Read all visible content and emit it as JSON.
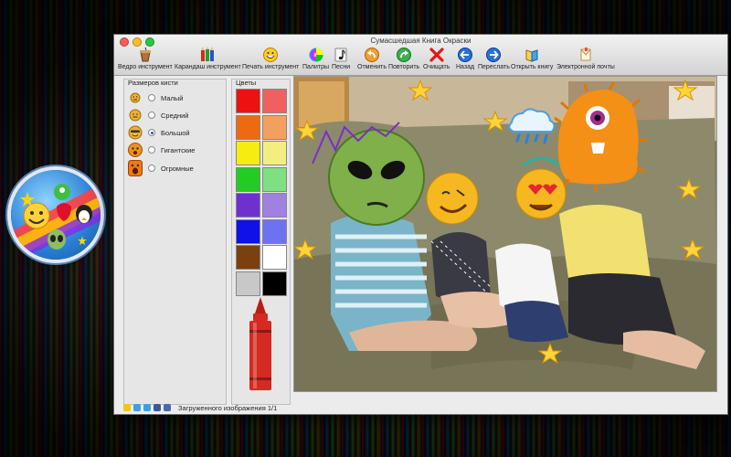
{
  "window": {
    "title": "Сумасшедшая Книга Окраски"
  },
  "toolbar": {
    "items": [
      {
        "label": "Ведро инструмент",
        "icon": "bucket-icon"
      },
      {
        "label": "Карандаш инструмент",
        "icon": "pencils-icon"
      },
      {
        "label": "Печать инструмент",
        "icon": "stamp-smiley-icon"
      },
      {
        "label": "Палитры",
        "icon": "palette-icon"
      },
      {
        "label": "Песни",
        "icon": "music-note-icon"
      },
      {
        "label": "Отменить",
        "icon": "undo-icon"
      },
      {
        "label": "Повторить",
        "icon": "redo-icon"
      },
      {
        "label": "Очищать",
        "icon": "clear-x-icon"
      },
      {
        "label": "Назад",
        "icon": "back-arrow-icon"
      },
      {
        "label": "Переслать",
        "icon": "forward-arrow-icon"
      },
      {
        "label": "Открыть книгу",
        "icon": "open-book-icon"
      },
      {
        "label": "Электронной почты",
        "icon": "email-icon"
      }
    ]
  },
  "brush_sizes": {
    "heading": "Размеров кисти",
    "options": [
      {
        "label": "Малый",
        "selected": false
      },
      {
        "label": "Средний",
        "selected": false
      },
      {
        "label": "Большой",
        "selected": true
      },
      {
        "label": "Гигантские",
        "selected": false
      },
      {
        "label": "Огромные",
        "selected": false
      }
    ]
  },
  "colors": {
    "heading": "Цветы",
    "swatches": [
      "#ee1111",
      "#f06060",
      "#ee6a10",
      "#f2a060",
      "#f5ec10",
      "#f2ef80",
      "#22cc22",
      "#7ee07e",
      "#7030d0",
      "#a080e0",
      "#1010e8",
      "#6f72f0",
      "#7a4010",
      "#ffffff",
      "#c8c8c8",
      "#000000"
    ],
    "selected_color": "#d42a20"
  },
  "status": {
    "text": "Загруженного изображения 1/1"
  }
}
